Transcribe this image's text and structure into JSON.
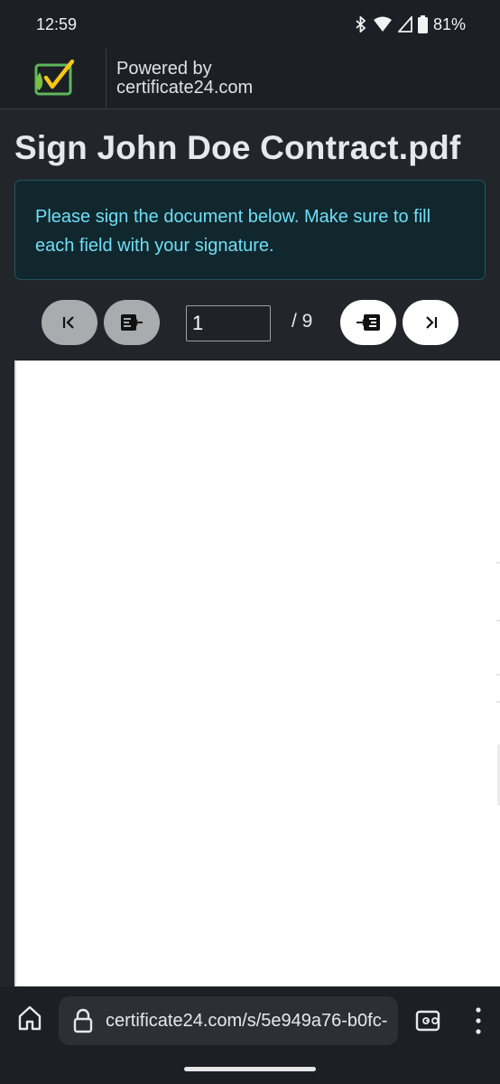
{
  "status_bar": {
    "time": "12:59",
    "battery": "81%",
    "icons": [
      "bluetooth-icon",
      "wifi-icon",
      "signal-icon",
      "battery-icon"
    ]
  },
  "header": {
    "logo": "certificate24-logo",
    "powered_by": "Powered by",
    "domain": "certificate24.com"
  },
  "page": {
    "title": "Sign John Doe Contract.pdf",
    "alert_text": "Please sign the document below. Make sure to fill each field with your signature."
  },
  "pager": {
    "first_icon": "first-page-icon",
    "prev_field_icon": "previous-field-icon",
    "current_page": "1",
    "total": "/ 9",
    "next_field_icon": "next-field-icon",
    "last_icon": "last-page-icon"
  },
  "browser": {
    "url": "certificate24.com/s/5e949a76-b0fc-",
    "icons": [
      "home-icon",
      "lock-icon",
      "tabs-icon",
      "more-menu-icon"
    ]
  },
  "colors": {
    "background": "#22262b",
    "alert_bg": "#11272e",
    "alert_text": "#6edff6",
    "logo_green": "#5cb85c",
    "logo_yellow": "#f5c518"
  }
}
